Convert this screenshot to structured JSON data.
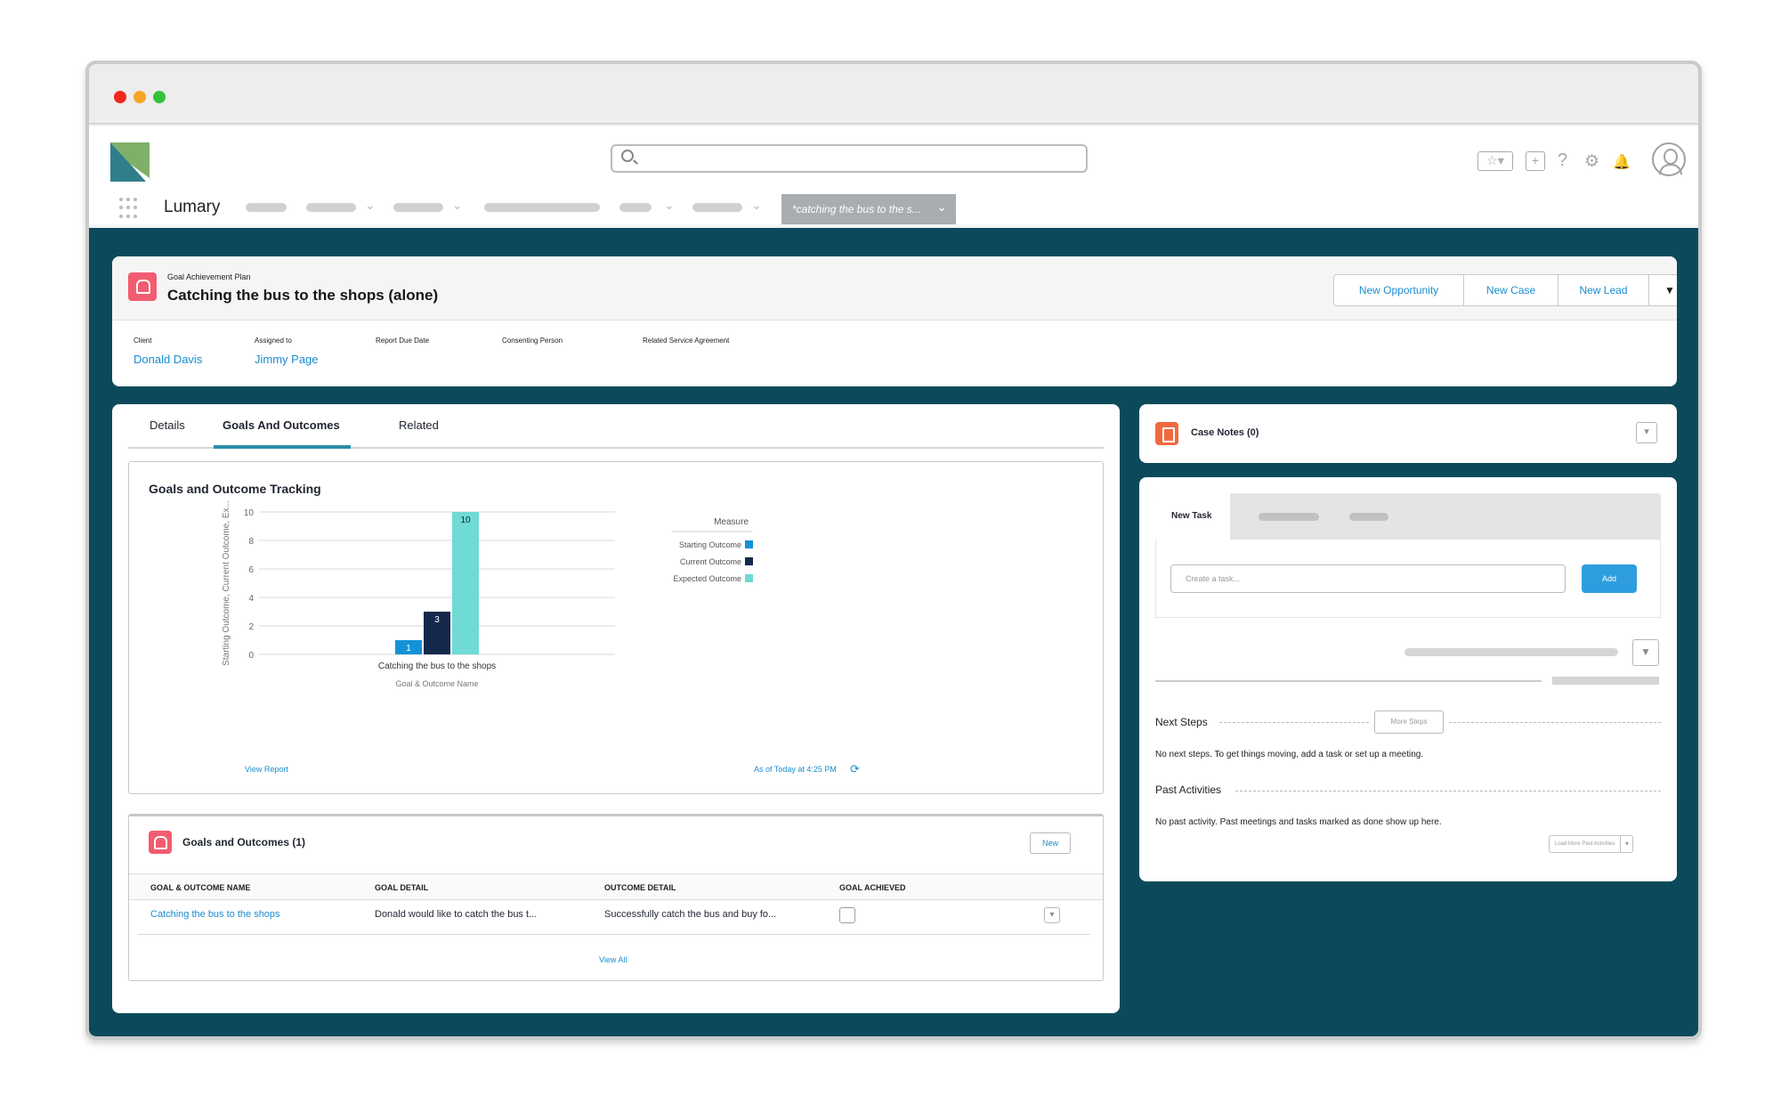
{
  "app": {
    "brand": "Lumary",
    "active_tab": "*catching the bus to the s..."
  },
  "colors": {
    "accent": "#1a8ccf",
    "page_bg": "#0c4a5b",
    "object_icon": "#f25c70",
    "notes_icon": "#f06a3f",
    "add_button": "#2e9de0"
  },
  "record": {
    "eyebrow": "Goal Achievement Plan",
    "title": "Catching the bus to the shops (alone)",
    "actions": [
      "New Opportunity",
      "New Case",
      "New Lead"
    ],
    "fields": [
      {
        "label": "Client",
        "value": "Donald Davis"
      },
      {
        "label": "Assigned to",
        "value": "Jimmy Page"
      },
      {
        "label": "Report Due Date",
        "value": ""
      },
      {
        "label": "Consenting Person",
        "value": ""
      },
      {
        "label": "Related Service Agreement",
        "value": ""
      }
    ]
  },
  "tabs": [
    "Details",
    "Goals And Outcomes",
    "Related"
  ],
  "chart": {
    "title": "Goals and Outcome Tracking",
    "view_report": "View Report",
    "as_of": "As of Today at 4:25 PM"
  },
  "chart_data": {
    "type": "bar",
    "categories": [
      "Catching the bus to the shops"
    ],
    "series": [
      {
        "name": "Starting Outcome",
        "values": [
          1
        ],
        "color": "#1592d6"
      },
      {
        "name": "Current Outcome",
        "values": [
          3
        ],
        "color": "#14284c"
      },
      {
        "name": "Expected Outcome",
        "values": [
          10
        ],
        "color": "#6fdad6"
      }
    ],
    "xlabel": "Goal & Outcome Name",
    "ylabel": "Starting Outcome, Current Outcome, Ex...",
    "legend_title": "Measure",
    "legend_placement": "top-right",
    "yticks": [
      "0",
      "2",
      "4",
      "6",
      "8",
      "10"
    ],
    "ylim": [
      0,
      10
    ],
    "grid": true
  },
  "goals_table": {
    "title": "Goals and Outcomes (1)",
    "new_label": "New",
    "columns": [
      "GOAL & OUTCOME NAME",
      "GOAL DETAIL",
      "OUTCOME DETAIL",
      "GOAL ACHIEVED"
    ],
    "rows": [
      [
        "Catching the bus to the shops",
        "Donald would like to catch the bus t...",
        "Successfully catch the bus and buy fo..."
      ]
    ],
    "view_all": "View All"
  },
  "case_notes": {
    "title": "Case Notes (0)"
  },
  "activity": {
    "new_task_tab": "New Task",
    "task_placeholder": "Create a task...",
    "add_label": "Add",
    "next_steps_label": "Next Steps",
    "more_steps_label": "More Steps",
    "next_steps_msg": "No next steps. To get things moving, add a task or set up a meeting.",
    "past_label": "Past Activities",
    "past_msg": "No past activity. Past meetings and tasks marked as done show up here.",
    "load_more": "Load More Past Activities"
  }
}
